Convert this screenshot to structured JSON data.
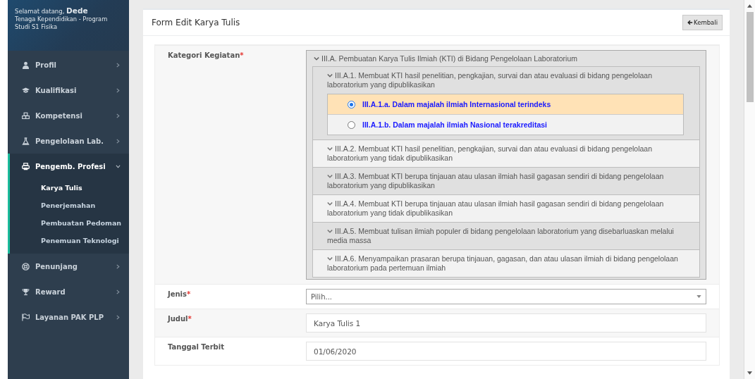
{
  "sidebar": {
    "greeting": "Selamat datang,",
    "user_name": "Dede",
    "role": "Tenaga Kependidikan - Program Studi S1 Fisika",
    "menu": [
      {
        "label": "Profil",
        "expanded": false
      },
      {
        "label": "Kualifikasi",
        "expanded": false
      },
      {
        "label": "Kompetensi",
        "expanded": false
      },
      {
        "label": "Pengelolaan Lab.",
        "expanded": false
      },
      {
        "label": "Pengemb. Profesi",
        "expanded": true,
        "children": [
          {
            "label": "Karya Tulis",
            "selected": true
          },
          {
            "label": "Penerjemahan",
            "selected": false
          },
          {
            "label": "Pembuatan Pedoman",
            "selected": false
          },
          {
            "label": "Penemuan Teknologi",
            "selected": false
          }
        ]
      },
      {
        "label": "Penunjang",
        "expanded": false
      },
      {
        "label": "Reward",
        "expanded": false
      },
      {
        "label": "Layanan PAK PLP",
        "expanded": false
      }
    ]
  },
  "form": {
    "title": "Form Edit Karya Tulis",
    "back_button": "Kembali",
    "fields": [
      {
        "kind": "tree",
        "label": "Kategori Kegiatan",
        "required_mark": "*",
        "tree": {
          "label": "III.A. Pembuatan Karya Tulis Ilmiah (KTI) di Bidang Pengelolaan Laboratorium",
          "expanded": true,
          "children": [
            {
              "label": "III.A.1. Membuat KTI hasil penelitian, pengkajian, survai dan atau evaluasi di bidang pengelolaan laboratorium yang dipublikasikan",
              "expanded": true,
              "options": [
                {
                  "label": "III.A.1.a. Dalam majalah ilmiah Internasional terindeks",
                  "selected": true
                },
                {
                  "label": "III.A.1.b. Dalam majalah ilmiah Nasional terakreditasi",
                  "selected": false
                }
              ]
            },
            {
              "label": "III.A.2. Membuat KTI hasil penelitian, pengkajian, survai dan atau evaluasi di bidang pengelolaan laboratorium yang tidak dipublikasikan",
              "expanded": false
            },
            {
              "label": "III.A.3. Membuat KTI berupa tinjauan atau ulasan ilmiah hasil gagasan sendiri di bidang pengelolaan laboratorium yang dipublikasikan",
              "expanded": false
            },
            {
              "label": "III.A.4. Membuat KTI berupa tinjauan atau ulasan ilmiah hasil gagasan sendiri di bidang pengelolaan laboratorium yang tidak dipublikasikan",
              "expanded": false
            },
            {
              "label": "III.A.5. Membuat tulisan ilmiah populer di bidang pengelolaan laboratorium yang disebarluaskan melalui media massa",
              "expanded": false
            },
            {
              "label": "III.A.6. Menyampaikan prasaran berupa tinjauan, gagasan, dan atau ulasan ilmiah di bidang pengelolaan laboratorium pada pertemuan ilmiah",
              "expanded": false
            }
          ]
        }
      },
      {
        "kind": "select",
        "label": "Jenis",
        "required_mark": "*",
        "placeholder": "Pilih..."
      },
      {
        "kind": "text",
        "label": "Judul",
        "required_mark": "*",
        "value": "Karya Tulis 1"
      },
      {
        "kind": "text",
        "label": "Tanggal Terbit",
        "value": "01/06/2020"
      }
    ]
  }
}
